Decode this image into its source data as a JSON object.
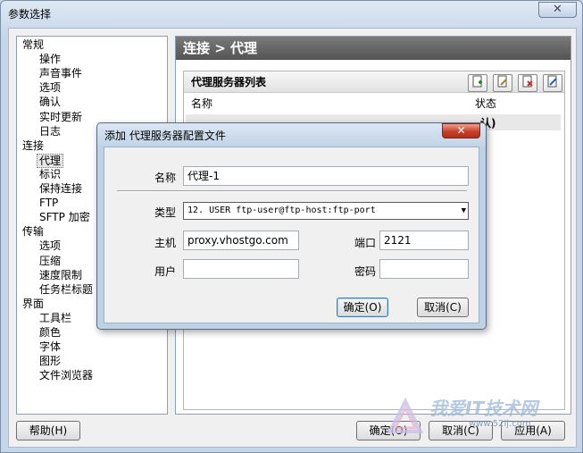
{
  "window": {
    "title": "参数选择",
    "close_glyph": "✕"
  },
  "tree": {
    "items": [
      {
        "label": "常规",
        "level": 0
      },
      {
        "label": "操作",
        "level": 1
      },
      {
        "label": "声音事件",
        "level": 1
      },
      {
        "label": "选项",
        "level": 1
      },
      {
        "label": "确认",
        "level": 1
      },
      {
        "label": "实时更新",
        "level": 1
      },
      {
        "label": "日志",
        "level": 1
      },
      {
        "label": "连接",
        "level": 0
      },
      {
        "label": "代理",
        "level": 1,
        "selected": true
      },
      {
        "label": "标识",
        "level": 1
      },
      {
        "label": "保持连接",
        "level": 1
      },
      {
        "label": "FTP",
        "level": 1
      },
      {
        "label": "SFTP 加密",
        "level": 1
      },
      {
        "label": "传输",
        "level": 0
      },
      {
        "label": "选项",
        "level": 1
      },
      {
        "label": "压缩",
        "level": 1
      },
      {
        "label": "速度限制",
        "level": 1
      },
      {
        "label": "任务栏标题",
        "level": 1
      },
      {
        "label": "界面",
        "level": 0
      },
      {
        "label": "工具栏",
        "level": 1
      },
      {
        "label": "颜色",
        "level": 1
      },
      {
        "label": "字体",
        "level": 1
      },
      {
        "label": "图形",
        "level": 1
      },
      {
        "label": "文件浏览器",
        "level": 1
      }
    ]
  },
  "pane": {
    "header": "连接 > 代理",
    "list_title": "代理服务器列表",
    "col_name": "名称",
    "col_status": "状态",
    "row_status": "认)"
  },
  "bottom": {
    "help": "帮助(H)",
    "ok": "确定(O)",
    "cancel": "取消(C)",
    "apply": "应用(A)"
  },
  "watermark": {
    "text": "我爱IT技术网",
    "url": "www.52ij.com"
  },
  "dialog": {
    "title": "添加 代理服务器配置文件",
    "close_glyph": "✕",
    "name_label": "名称",
    "name_value": "代理-1",
    "type_label": "类型",
    "type_value": "12. USER ftp-user@ftp-host:ftp-port",
    "host_label": "主机",
    "host_value": "proxy.vhostgo.com",
    "port_label": "端口",
    "port_value": "2121",
    "user_label": "用户",
    "user_value": "",
    "password_label": "密码",
    "password_value": "",
    "ok": "确定(O)",
    "cancel": "取消(C)"
  },
  "colors": {
    "header_bg": "#5f5f5f",
    "accent": "#3c7fb1",
    "close_red": "#c8402a"
  },
  "icons": {
    "add": "add-icon",
    "edit": "edit-icon",
    "delete": "delete-icon",
    "connect": "connect-icon",
    "dropdown": "chevron-down-icon"
  }
}
